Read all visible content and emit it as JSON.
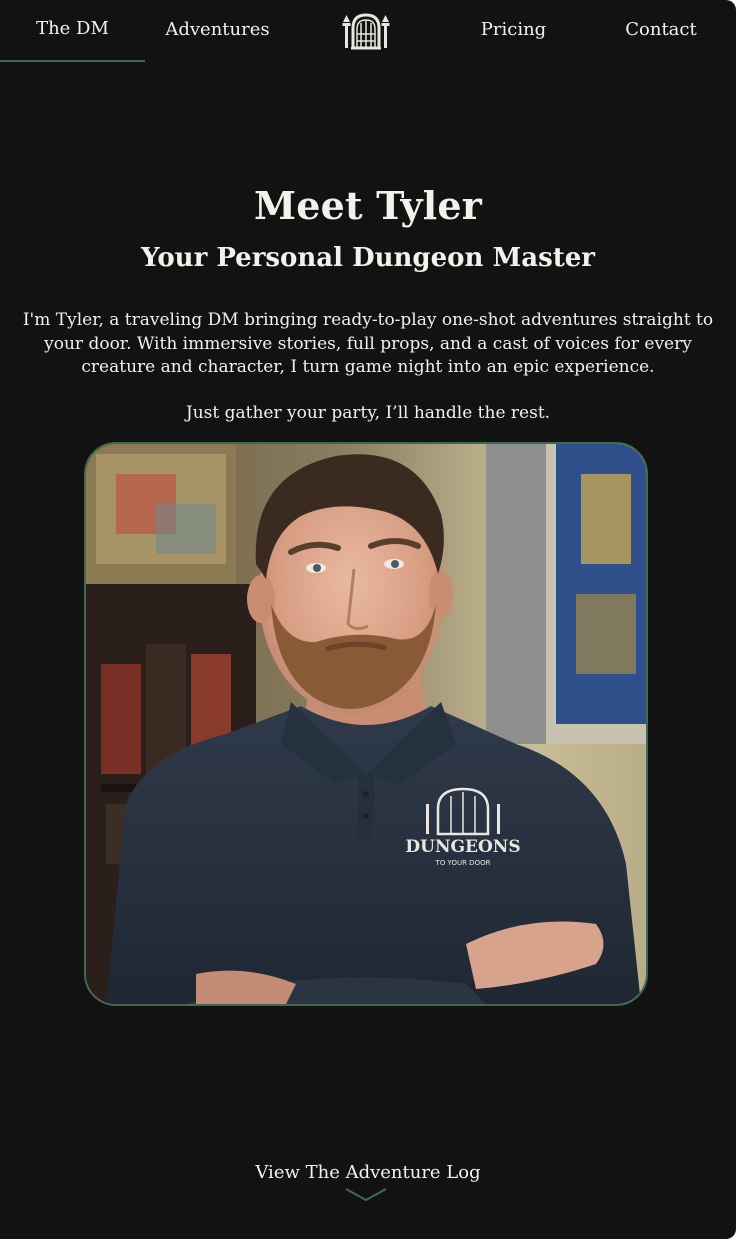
{
  "nav": {
    "items": [
      {
        "label": "The DM",
        "active": true
      },
      {
        "label": "Adventures",
        "active": false
      },
      {
        "label": "Pricing",
        "active": false
      },
      {
        "label": "Contact",
        "active": false
      }
    ],
    "logo_icon": "dungeon-gate-icon"
  },
  "hero": {
    "title": "Meet Tyler",
    "subtitle": "Your Personal Dungeon Master",
    "intro": "I'm Tyler, a traveling DM bringing ready-to-play one-shot adventures straight to your door. With immersive stories, full props, and a cast of voices for every creature and character, I turn game night into an epic experience.",
    "tagline": "Just gather your party, I’ll handle the rest."
  },
  "portrait": {
    "shirt_logo_line1": "DUNGEONS",
    "shirt_logo_line2": "TO YOUR DOOR"
  },
  "footer": {
    "link_label": "View The Adventure Log",
    "chevron_icon": "chevron-down-icon"
  },
  "colors": {
    "background": "#121212",
    "text": "#f4f1ea",
    "accent_green": "#3e6b4f"
  }
}
